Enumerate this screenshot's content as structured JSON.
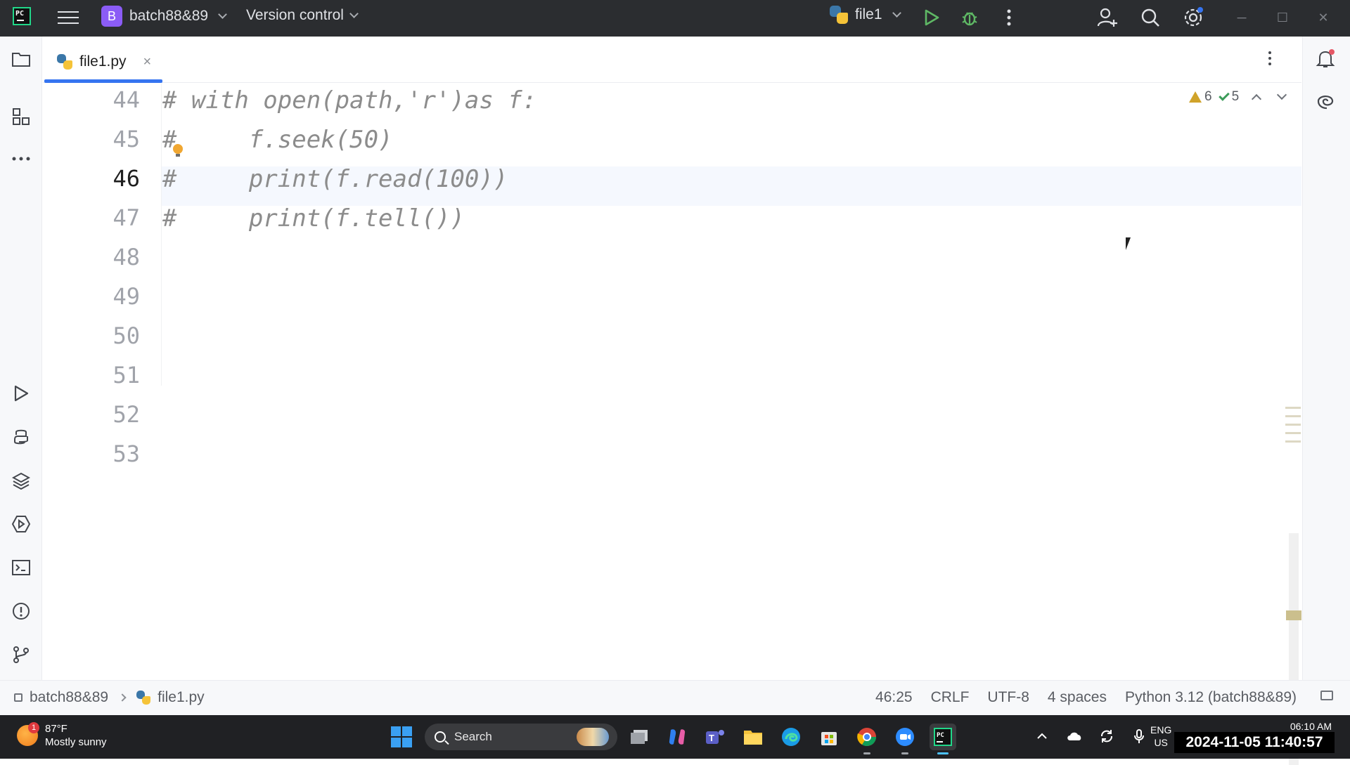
{
  "titlebar": {
    "project_initial": "B",
    "project_name": "batch88&89",
    "version_control": "Version control",
    "run_config": "file1"
  },
  "tabs": [
    {
      "label": "file1.py",
      "close": "×"
    }
  ],
  "inspections": {
    "warnings": "6",
    "ok": "5"
  },
  "editor": {
    "current_line": "46",
    "lines": [
      {
        "number": "44",
        "code": "# with open(path,'r')as f:"
      },
      {
        "number": "45",
        "code": "#     f.seek(50)"
      },
      {
        "number": "46",
        "code": "#     print(f.read(100))"
      },
      {
        "number": "47",
        "code": "#     print(f.tell())"
      },
      {
        "number": "48",
        "code": ""
      },
      {
        "number": "49",
        "code": ""
      },
      {
        "number": "50",
        "code": ""
      },
      {
        "number": "51",
        "code": ""
      },
      {
        "number": "52",
        "code": ""
      },
      {
        "number": "53",
        "code": ""
      }
    ]
  },
  "statusbar": {
    "breadcrumb_project": "batch88&89",
    "breadcrumb_file": "file1.py",
    "caret_position": "46:25",
    "line_separator": "CRLF",
    "encoding": "UTF-8",
    "indent": "4 spaces",
    "interpreter": "Python 3.12 (batch88&89)"
  },
  "taskbar": {
    "weather_temp": "87°F",
    "weather_desc": "Mostly sunny",
    "weather_badge": "1",
    "search_label": "Search",
    "lang_line1": "ENG",
    "lang_line2": "US",
    "clock_time": "06:10 AM",
    "timestamp_overlay": "2024-11-05 11:40:57"
  },
  "colors": {
    "titlebar_bg": "#2b2d30",
    "accent": "#3574f0",
    "comment": "#8c8c8c",
    "run_green": "#5fb865",
    "taskbar_bg": "#202124"
  }
}
